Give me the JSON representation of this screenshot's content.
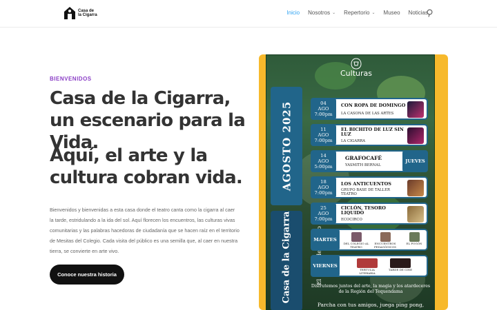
{
  "header": {
    "logo_text_line1": "Casa de",
    "logo_text_line2": "la Cigarra",
    "nav": [
      {
        "label": "Inicio",
        "active": true,
        "has_dropdown": false
      },
      {
        "label": "Nosotros",
        "active": false,
        "has_dropdown": true
      },
      {
        "label": "Repertorio",
        "active": false,
        "has_dropdown": true
      },
      {
        "label": "Museo",
        "active": false,
        "has_dropdown": false
      },
      {
        "label": "Noticias",
        "active": false,
        "has_dropdown": false
      }
    ],
    "dropdown_glyph": "⌄",
    "search_icon": "search-icon"
  },
  "hero": {
    "eyebrow": "BIENVENIDOS",
    "title": "Casa de la Cigarra, un escenario para la Vida.",
    "subtitle": "Aquí, el arte y la cultura cobran vida.",
    "paragraph": "Bienvenidos y bienvenidas a esta casa donde el teatro canta como la cigarra al caer la tarde, estridulando a la ida del sol. Aquí florecen los encuentros, las culturas vivas comunitarias y las palabras hacedoras de ciudadanía que se hacen raíz en el territorio de Mesitas del Colegio. Cada visita del público es una semilla que, al caer en nuestra tierra, se convierte en arte vivo.",
    "cta_label": "Conoce nuestra historia"
  },
  "poster": {
    "brand": "Culturas",
    "month": "AGOSTO 2025",
    "side_title": "Casa de la Cigarra",
    "side_subtitle": "El teatro del pueblo",
    "events": [
      {
        "day": "04",
        "month": "AGO",
        "time": "7:00pm",
        "title": "CON ROPA DE DOMINGO",
        "subtitle": "LA CASONA DE LAS ARTES"
      },
      {
        "day": "11",
        "month": "AGO",
        "time": "7:00pm",
        "title": "EL BICHITO DE LUZ SIN LUZ",
        "subtitle": "LA CIGARRA"
      },
      {
        "day": "14",
        "month": "AGO",
        "time": "5:00pm",
        "title": "GRAFOCAFÉ",
        "subtitle": "YASMITH BERNAL",
        "tag": "JUEVES"
      },
      {
        "day": "18",
        "month": "AGO",
        "time": "7:00pm",
        "title": "LOS ANTICUENTOS",
        "subtitle": "GRUPO BASE DE TALLER TEATRO"
      },
      {
        "day": "25",
        "month": "AGO",
        "time": "7:00pm",
        "title": "CICLÓN, TESORO LIQUIDO",
        "subtitle": "ECOCIRCO"
      }
    ],
    "weekly": [
      {
        "label": "MARTES",
        "items": [
          "DEL COLEGIO AL TEATRO",
          "ENCUENTROS PEDAGÓGICOS",
          "EL FOGÓN"
        ]
      },
      {
        "label": "VIERNES",
        "items": [
          "TERTULIA LITERARIA",
          "TARDE DE CINE"
        ]
      }
    ],
    "banner_1": "Disfrutemos juntos del arte, la magia y los atardeceres de la Región del Tequendama",
    "banner_2": "Parcha con tus amigos, juega ping pong,"
  },
  "colors": {
    "accent_blue": "#2ea3f2",
    "eyebrow_purple": "#8b3fc6",
    "poster_blue": "#21658a",
    "poster_yellow": "#f7b92c",
    "button_black": "#111111"
  }
}
